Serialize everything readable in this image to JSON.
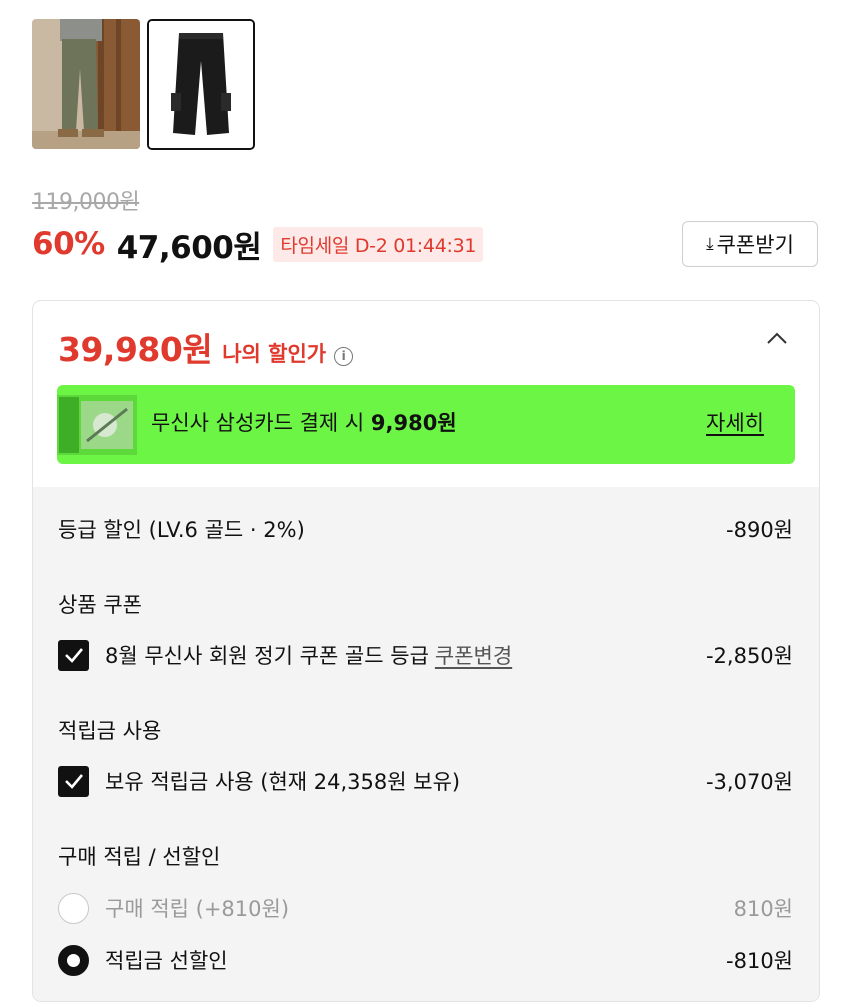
{
  "product": {
    "original_price": "119,000원",
    "discount_rate": "60%",
    "sale_price": "47,600원",
    "timesale_label": "타임세일 D-2 01:44:31"
  },
  "coupon_button": {
    "icon": "download-icon",
    "label": "쿠폰받기"
  },
  "my_price": {
    "amount": "39,980원",
    "label": "나의 할인가",
    "info_icon": "i"
  },
  "promo": {
    "text_prefix": "무신사 삼성카드 결제 시 ",
    "text_amount": "9,980원",
    "detail_label": "자세히",
    "background": "#6cf545"
  },
  "breakdown": {
    "grade_discount": {
      "label": "등급 할인 (LV.6 골드 · 2%)",
      "amount": "-890원"
    },
    "product_coupon": {
      "title": "상품 쿠폰",
      "item_label": "8월 무신사 회원 정기 쿠폰 골드 등급",
      "change_link": "쿠폰변경",
      "amount": "-2,850원",
      "checked": true
    },
    "points": {
      "title": "적립금 사용",
      "item_label": "보유 적립금 사용 (현재 24,358원 보유)",
      "amount": "-3,070원",
      "checked": true
    },
    "purchase": {
      "title": "구매 적립 / 선할인",
      "options": [
        {
          "label": "구매 적립 (+810원)",
          "amount": "810원",
          "selected": false
        },
        {
          "label": "적립금 선할인",
          "amount": "-810원",
          "selected": true
        }
      ]
    }
  },
  "colors": {
    "accent_red": "#e03a2e",
    "promo_green": "#6cf545",
    "panel_gray": "#f4f4f4"
  }
}
